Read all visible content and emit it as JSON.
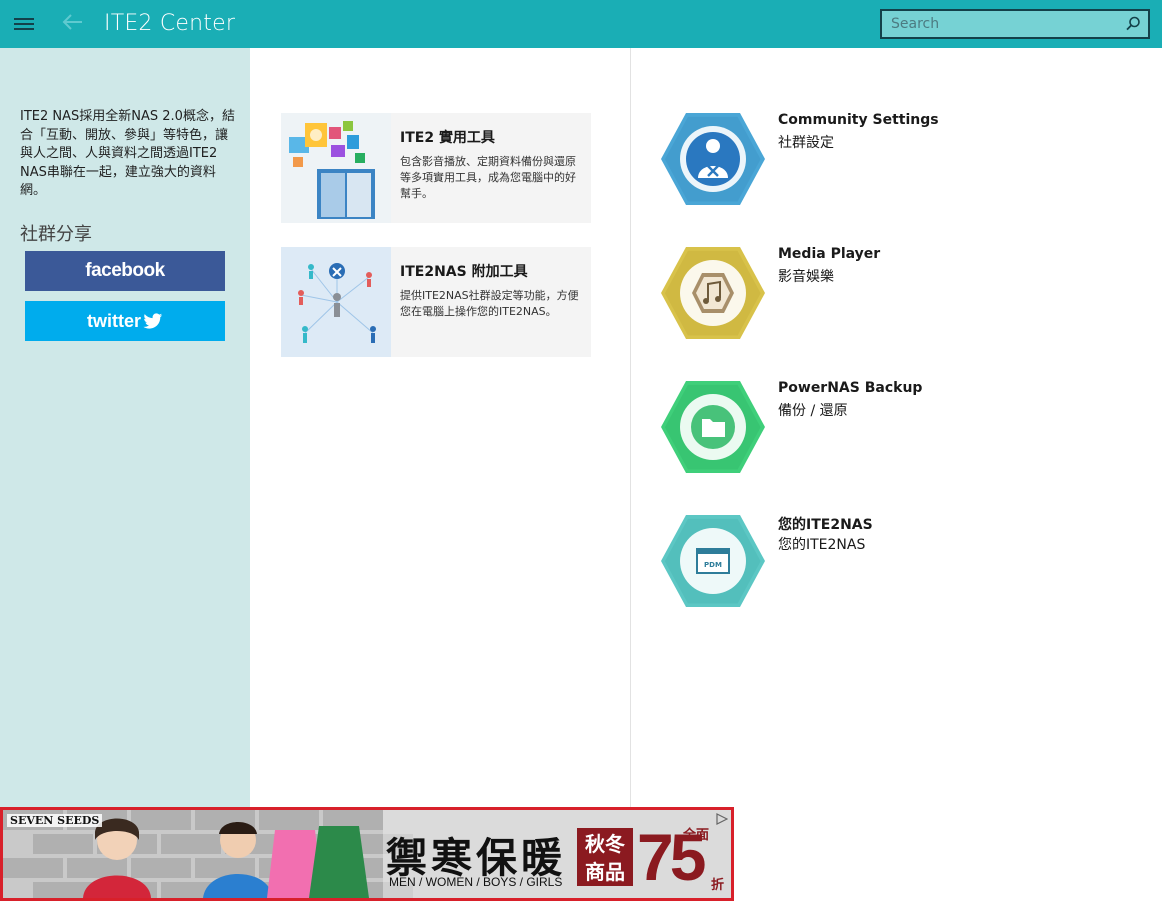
{
  "header": {
    "title": "ITE2 Center",
    "search_placeholder": "Search"
  },
  "sidebar": {
    "intro": "ITE2 NAS採用全新NAS 2.0概念，結合「互動、開放、參與」等特色，讓與人之間、人與資料之間透過ITE2 NAS串聯在一起，建立強大的資料網。",
    "share_title": "社群分享",
    "facebook_label": "facebook",
    "twitter_label": "twitter"
  },
  "tools": [
    {
      "title": "ITE2 實用工具",
      "desc": "包含影音播放、定期資料備份與還原等多項實用工具，成為您電腦中的好幫手。"
    },
    {
      "title": "ITE2NAS 附加工具",
      "desc": "提供ITE2NAS社群設定等功能，方便您在電腦上操作您的ITE2NAS。"
    }
  ],
  "apps": [
    {
      "name": "Community Settings",
      "sub": "社群設定",
      "color": "#4aa6d6",
      "icon": "community-settings-icon"
    },
    {
      "name": "Media Player",
      "sub": "影音娛樂",
      "color": "#d8c24a",
      "icon": "music-note-icon"
    },
    {
      "name": "PowerNAS Backup",
      "sub": "備份 / 還原",
      "color": "#3fcf7a",
      "icon": "folder-icon"
    },
    {
      "name": "您的ITE2NAS",
      "sub": "您的ITE2NAS",
      "color": "#5cc7c4",
      "icon": "pdm-window-icon"
    }
  ],
  "ad": {
    "brand": "SEVEN SEEDS",
    "headline": "禦寒保暖",
    "subline": "MEN / WOMEN / BOYS / GIRLS",
    "season": "秋冬商品",
    "season_line1": "秋冬",
    "season_line2": "商品",
    "all_label": "全面",
    "discount": "75",
    "fold_label": "折"
  }
}
